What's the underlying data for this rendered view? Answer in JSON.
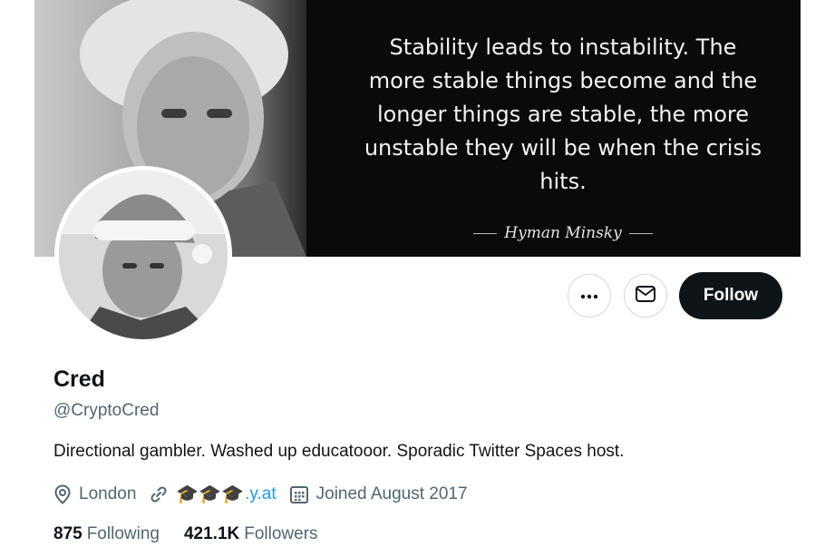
{
  "banner": {
    "quote_lines": [
      "Stability leads to instability. The",
      "more stable things become and the",
      "longer things are stable, the more",
      "unstable they will be when the crisis",
      "hits."
    ],
    "quote_author": "Hyman Minsky"
  },
  "actions": {
    "more_icon": "more-horizontal-icon",
    "message_icon": "envelope-icon",
    "follow_label": "Follow"
  },
  "profile": {
    "display_name": "Cred",
    "handle": "@CryptoCred",
    "bio": "Directional gambler. Washed up educatooor. Sporadic Twitter Spaces host.",
    "location": "London",
    "link_emojis": "🎓🎓🎓",
    "link_suffix": ".y.at",
    "joined": "Joined August 2017"
  },
  "stats": {
    "following_count": "875",
    "following_label": "Following",
    "followers_count": "421.1K",
    "followers_label": "Followers"
  },
  "colors": {
    "text_primary": "#0f1419",
    "text_secondary": "#536471",
    "link": "#1d9bf0",
    "button_dark": "#0f1419",
    "border": "#cfd9de"
  }
}
